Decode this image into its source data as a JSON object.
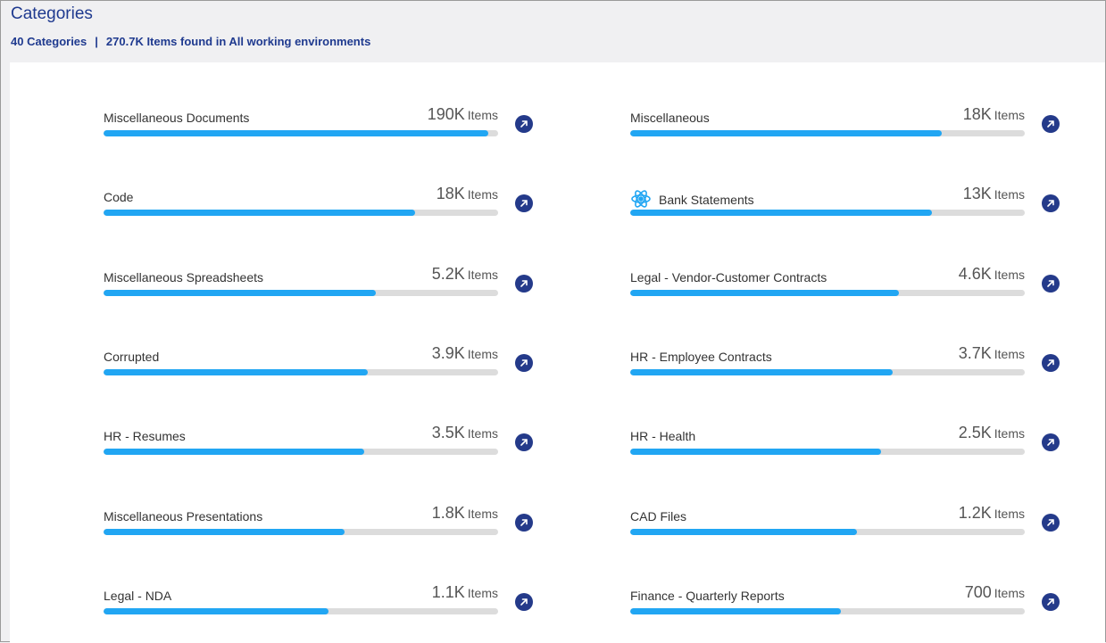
{
  "header": {
    "title": "Categories",
    "summary_count": "40 Categories",
    "separator": "|",
    "summary_items": "270.7K Items found in All working environments"
  },
  "unit_label": "Items",
  "colors": {
    "bar_fill": "#21a6f3",
    "bar_track": "#dcdcdc",
    "button": "#243a8a",
    "title": "#1f3a8f"
  },
  "categories": [
    {
      "label": "Miscellaneous Documents",
      "count": "190K",
      "fill": 0.975,
      "icon": ""
    },
    {
      "label": "Miscellaneous",
      "count": "18K",
      "fill": 0.79,
      "icon": ""
    },
    {
      "label": "Code",
      "count": "18K",
      "fill": 0.79,
      "icon": ""
    },
    {
      "label": "Bank Statements",
      "count": "13K",
      "fill": 0.765,
      "icon": "atom-icon"
    },
    {
      "label": "Miscellaneous Spreadsheets",
      "count": "5.2K",
      "fill": 0.69,
      "icon": ""
    },
    {
      "label": "Legal - Vendor-Customer Contracts",
      "count": "4.6K",
      "fill": 0.68,
      "icon": ""
    },
    {
      "label": "Corrupted",
      "count": "3.9K",
      "fill": 0.67,
      "icon": ""
    },
    {
      "label": "HR - Employee Contracts",
      "count": "3.7K",
      "fill": 0.665,
      "icon": ""
    },
    {
      "label": "HR - Resumes",
      "count": "3.5K",
      "fill": 0.66,
      "icon": ""
    },
    {
      "label": "HR - Health",
      "count": "2.5K",
      "fill": 0.635,
      "icon": ""
    },
    {
      "label": "Miscellaneous Presentations",
      "count": "1.8K",
      "fill": 0.61,
      "icon": ""
    },
    {
      "label": "CAD Files",
      "count": "1.2K",
      "fill": 0.575,
      "icon": ""
    },
    {
      "label": "Legal - NDA",
      "count": "1.1K",
      "fill": 0.57,
      "icon": ""
    },
    {
      "label": "Finance - Quarterly Reports",
      "count": "700",
      "fill": 0.535,
      "icon": ""
    }
  ]
}
